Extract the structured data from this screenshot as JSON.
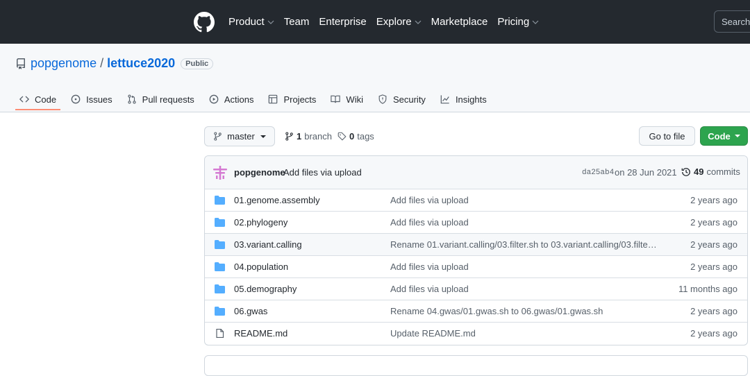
{
  "topnav": {
    "items": [
      {
        "label": "Product",
        "dropdown": true
      },
      {
        "label": "Team",
        "dropdown": false
      },
      {
        "label": "Enterprise",
        "dropdown": false
      },
      {
        "label": "Explore",
        "dropdown": true
      },
      {
        "label": "Marketplace",
        "dropdown": false
      },
      {
        "label": "Pricing",
        "dropdown": true
      }
    ],
    "search_placeholder": "Search"
  },
  "repo": {
    "owner": "popgenome",
    "separator": "/",
    "name": "lettuce2020",
    "visibility": "Public"
  },
  "tabs": [
    {
      "label": "Code",
      "icon": "code-icon",
      "active": true
    },
    {
      "label": "Issues",
      "icon": "issue-icon"
    },
    {
      "label": "Pull requests",
      "icon": "pull-request-icon"
    },
    {
      "label": "Actions",
      "icon": "play-icon"
    },
    {
      "label": "Projects",
      "icon": "table-icon"
    },
    {
      "label": "Wiki",
      "icon": "book-icon"
    },
    {
      "label": "Security",
      "icon": "shield-icon"
    },
    {
      "label": "Insights",
      "icon": "graph-icon"
    }
  ],
  "branchbar": {
    "branch": "master",
    "branch_count": "1",
    "branch_label": "branch",
    "tag_count": "0",
    "tag_label": "tags",
    "goto_file": "Go to file",
    "code_button": "Code"
  },
  "latest_commit": {
    "author": "popgenome",
    "message": "Add files via upload",
    "sha": "da25ab4",
    "date": "on 28 Jun 2021",
    "commit_count": "49",
    "commit_label": "commits"
  },
  "files": [
    {
      "name": "01.genome.assembly",
      "type": "dir",
      "message": "Add files via upload",
      "age": "2 years ago"
    },
    {
      "name": "02.phylogeny",
      "type": "dir",
      "message": "Add files via upload",
      "age": "2 years ago"
    },
    {
      "name": "03.variant.calling",
      "type": "dir",
      "message": "Rename 01.variant.calling/03.filter.sh to 03.variant.calling/03.filte…",
      "age": "2 years ago"
    },
    {
      "name": "04.population",
      "type": "dir",
      "message": "Add files via upload",
      "age": "2 years ago"
    },
    {
      "name": "05.demography",
      "type": "dir",
      "message": "Add files via upload",
      "age": "11 months ago"
    },
    {
      "name": "06.gwas",
      "type": "dir",
      "message": "Rename 04.gwas/01.gwas.sh to 06.gwas/01.gwas.sh",
      "age": "2 years ago"
    },
    {
      "name": "README.md",
      "type": "file",
      "message": "Update README.md",
      "age": "2 years ago"
    }
  ],
  "colors": {
    "header_bg": "#24292f",
    "link_blue": "#0969da",
    "code_green": "#2da44e",
    "folder_blue": "#54aeff",
    "tab_underline": "#fd8c73"
  }
}
